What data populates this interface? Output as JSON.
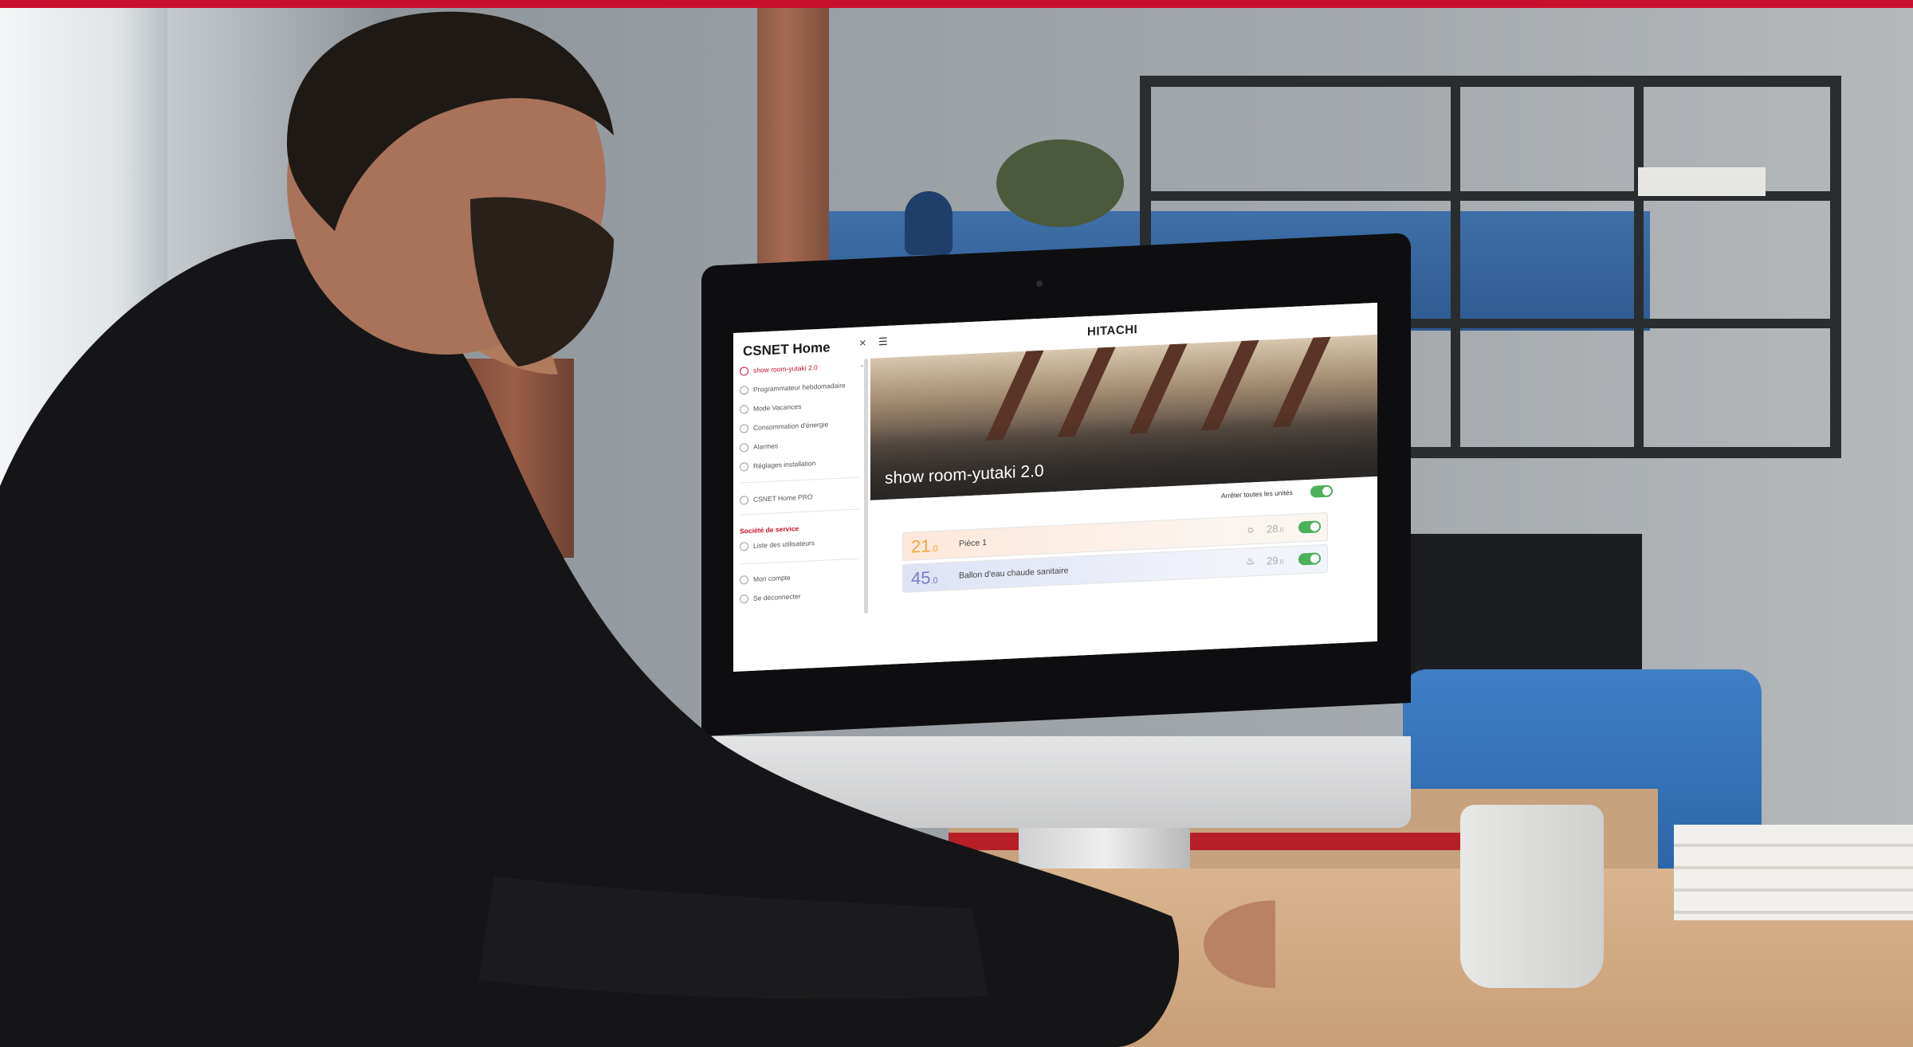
{
  "app": {
    "sidebar_title": "CSNET Home",
    "brand": "HITACHI"
  },
  "sidebar": {
    "items": [
      {
        "label": "show room-yutaki 2.0",
        "active": true,
        "icon": "house-icon"
      },
      {
        "label": "Programmateur hebdomadaire",
        "active": false,
        "icon": "clock-icon"
      },
      {
        "label": "Mode Vacances",
        "active": false,
        "icon": "suitcase-icon"
      },
      {
        "label": "Consommation d'énergie",
        "active": false,
        "icon": "energy-icon"
      },
      {
        "label": "Alarmes",
        "active": false,
        "icon": "alarm-icon"
      },
      {
        "label": "Réglages installation",
        "active": false,
        "icon": "settings-icon"
      },
      {
        "label": "CSNET Home PRO",
        "active": false,
        "icon": "pro-icon"
      }
    ],
    "section_title": "Société de service",
    "section_items": [
      {
        "label": "Liste des utilisateurs",
        "icon": "users-icon"
      }
    ],
    "footer_items": [
      {
        "label": "Mon compte",
        "icon": "user-icon"
      },
      {
        "label": "Se déconnecter",
        "icon": "logout-icon"
      }
    ]
  },
  "hero": {
    "title": "show room-yutaki 2.0"
  },
  "controls": {
    "stop_all_label": "Arrêter toutes les unités",
    "stop_all_on": true
  },
  "units": [
    {
      "temp_int": "21",
      "temp_dec": ".0",
      "name": "Pièce 1",
      "icon": "sun-icon",
      "setpoint_int": "28",
      "setpoint_dec": ".0",
      "on": true
    },
    {
      "temp_int": "45",
      "temp_dec": ".0",
      "name": "Ballon d'eau chaude sanitaire",
      "icon": "water-heater-icon",
      "setpoint_int": "29",
      "setpoint_dec": ".0",
      "on": true
    }
  ],
  "colors": {
    "accent_red": "#c8102e",
    "toggle_green": "#4cb05c",
    "heat_temp": "#f2a63a",
    "dhw_temp": "#7a78c9"
  }
}
